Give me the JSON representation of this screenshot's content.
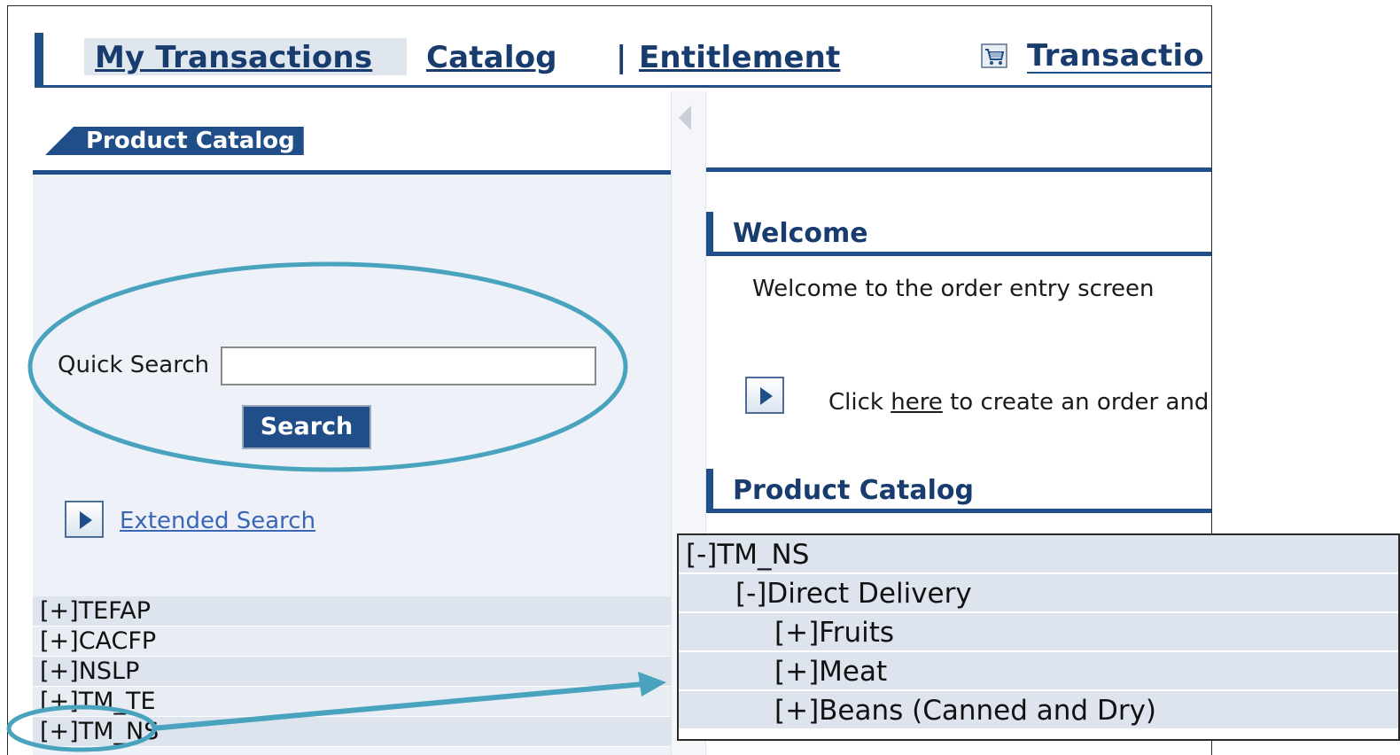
{
  "nav": {
    "tabs": [
      "My Transactions",
      "Catalog",
      "Entitlement",
      "Transactio"
    ],
    "separator": "|",
    "cart_icon": "shopping-cart-icon"
  },
  "left_panel": {
    "header_tab": "Product Catalog",
    "quick_search_label": "Quick Search",
    "quick_search_value": "",
    "search_button": "Search",
    "extended_search_link": "Extended Search",
    "tree": [
      "[+]TEFAP",
      "[+]CACFP",
      "[+]NSLP",
      "[+]TM_TE",
      "[+]TM_NS"
    ]
  },
  "right_panel": {
    "welcome_title": "Welcome",
    "welcome_text": "Welcome to the order entry screen",
    "click_prefix": "Click ",
    "click_link": "here",
    "click_suffix": " to create an order and",
    "catalog_title": "Product Catalog"
  },
  "callout": {
    "rows": [
      {
        "text": "[-]TM_NS",
        "level": 0
      },
      {
        "text": "[-]Direct Delivery",
        "level": 1
      },
      {
        "text": "[+]Fruits",
        "level": 2
      },
      {
        "text": "[+]Meat",
        "level": 2
      },
      {
        "text": "[+]Beans (Canned and Dry)",
        "level": 2
      }
    ]
  },
  "colors": {
    "brand_blue": "#1f4e88",
    "annotation_teal": "#4aa3be",
    "panel_bg": "#eef2f8"
  }
}
